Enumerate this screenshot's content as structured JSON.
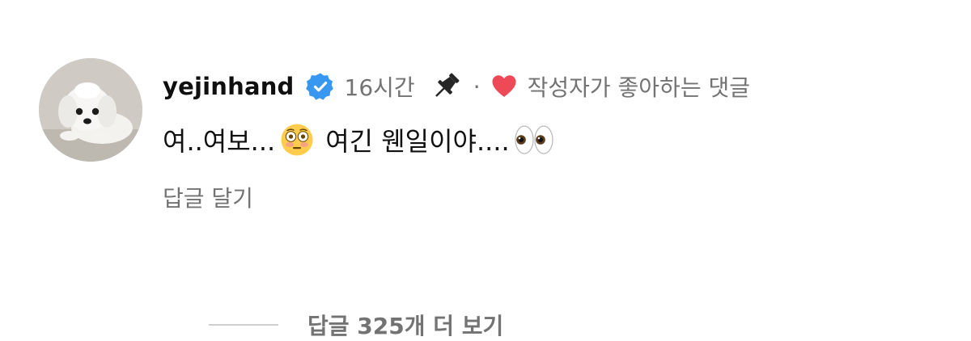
{
  "comment": {
    "username": "yejinhand",
    "verified": true,
    "time": "16시간",
    "pinned": true,
    "separator": "·",
    "liked_by_creator": "작성자가 좋아하는 댓글",
    "text_part1": "여..여보...",
    "emoji1": "flushed-face",
    "text_part2": "여긴 웬일이야....",
    "emoji2": "eyes",
    "reply_label": "답글 달기"
  },
  "replies": {
    "view_more_label": "답글 325개 더 보기"
  },
  "colors": {
    "verified_blue": "#3897F0",
    "heart_red": "#ED4956",
    "secondary_text": "#737373"
  }
}
